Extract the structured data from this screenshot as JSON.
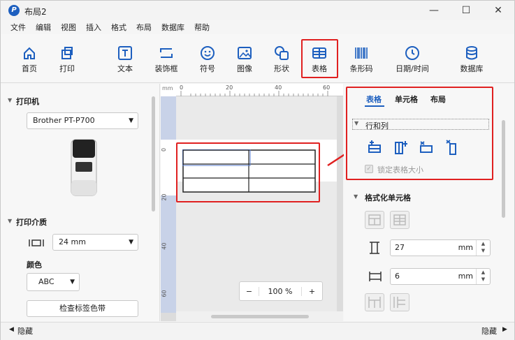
{
  "window": {
    "title": "布局2",
    "minimize": "—",
    "maximize": "☐",
    "close": "✕"
  },
  "menu": [
    "文件",
    "编辑",
    "视图",
    "插入",
    "格式",
    "布局",
    "数据库",
    "帮助"
  ],
  "ribbon": {
    "home": "首页",
    "print": "打印",
    "text": "文本",
    "frame": "装饰框",
    "symbol": "符号",
    "image": "图像",
    "shape": "形状",
    "table": "表格",
    "barcode": "条形码",
    "datetime": "日期/时间",
    "database": "数据库"
  },
  "left_panel": {
    "printer_section": "打印机",
    "printer_value": "Brother PT-P700",
    "media_section": "打印介质",
    "media_width": "24 mm",
    "color_label": "颜色",
    "color_value": "ABC",
    "check_tape_button": "检查标签色带"
  },
  "canvas": {
    "ruler_unit": "mm",
    "hruler_ticks": [
      "0",
      "20",
      "40",
      "60"
    ],
    "vruler_ticks": [
      "0",
      "20",
      "40",
      "60"
    ],
    "zoom_minus": "−",
    "zoom_value": "100 %",
    "zoom_plus": "+"
  },
  "right_panel": {
    "tabs": [
      "表格",
      "单元格",
      "布局"
    ],
    "rows_cols_section": "行和列",
    "lock_size_label": "锁定表格大小",
    "format_cells_section": "格式化单元格",
    "height_value": "27",
    "height_unit": "mm",
    "width_value": "6",
    "width_unit": "mm"
  },
  "status_bar": {
    "hide_left": "隐藏",
    "hide_right": "隐藏"
  },
  "colors": {
    "accent": "#1d5fbf",
    "highlight": "#e02020",
    "ruler_blue": "#c8d2e8"
  }
}
